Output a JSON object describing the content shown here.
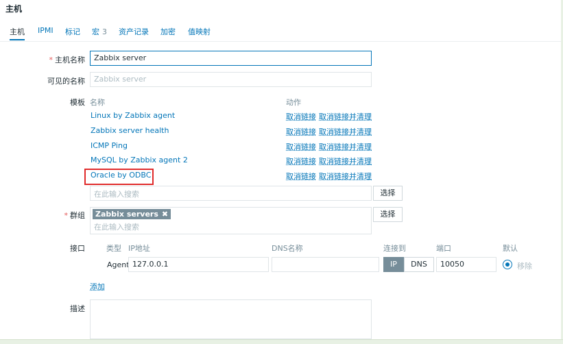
{
  "dialog": {
    "title": "主机"
  },
  "tabs": [
    {
      "label": "主机"
    },
    {
      "label": "IPMI"
    },
    {
      "label": "标记"
    },
    {
      "label": "宏",
      "count": "3"
    },
    {
      "label": "资产记录"
    },
    {
      "label": "加密"
    },
    {
      "label": "值映射"
    }
  ],
  "form": {
    "hostname": {
      "label": "主机名称",
      "value": "Zabbix server"
    },
    "visible_name": {
      "label": "可见的名称",
      "placeholder": "Zabbix server"
    },
    "templates": {
      "label": "模板",
      "col_name": "名称",
      "col_action": "动作",
      "items": [
        {
          "name": "Linux by Zabbix agent",
          "unlink": "取消链接",
          "unlink_clear": "取消链接并清理"
        },
        {
          "name": "Zabbix server health",
          "unlink": "取消链接",
          "unlink_clear": "取消链接并清理"
        },
        {
          "name": "ICMP Ping",
          "unlink": "取消链接",
          "unlink_clear": "取消链接并清理"
        },
        {
          "name": "MySQL by Zabbix agent 2",
          "unlink": "取消链接",
          "unlink_clear": "取消链接并清理"
        },
        {
          "name": "Oracle by ODBC",
          "unlink": "取消链接",
          "unlink_clear": "取消链接并清理"
        }
      ],
      "search_placeholder": "在此输入搜索",
      "select_button": "选择"
    },
    "groups": {
      "label": "群组",
      "tag": "Zabbix servers",
      "tag_remove": "✖",
      "search_placeholder": "在此输入搜索",
      "select_button": "选择"
    },
    "interfaces": {
      "label": "接口",
      "col_type": "类型",
      "col_ip": "IP地址",
      "col_dns": "DNS名称",
      "col_connect": "连接到",
      "col_port": "端口",
      "col_default": "默认",
      "row": {
        "type": "Agent",
        "ip": "127.0.0.1",
        "dns": "",
        "ip_btn": "IP",
        "dns_btn": "DNS",
        "port": "10050",
        "remove": "移除"
      },
      "add": "添加"
    },
    "description": {
      "label": "描述",
      "value": ""
    }
  }
}
